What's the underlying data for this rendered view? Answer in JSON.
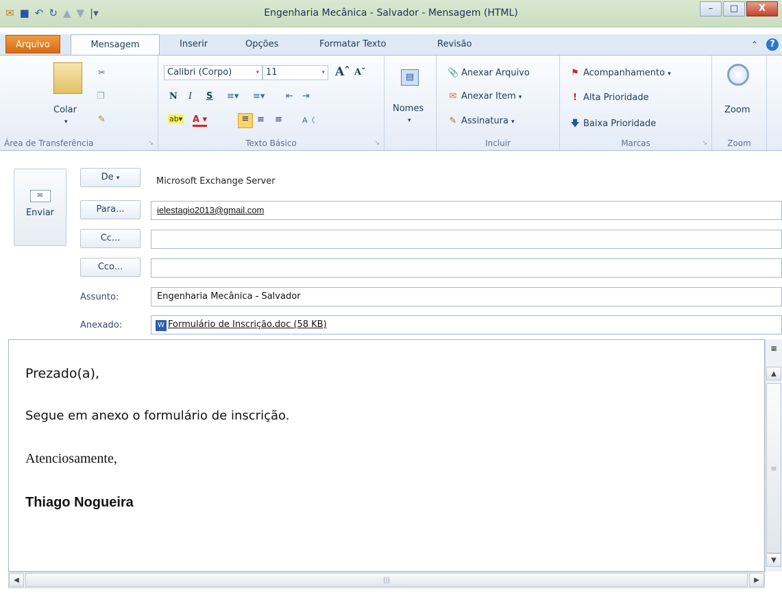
{
  "window": {
    "title": "Engenharia Mecânica - Salvador  -  Mensagem (HTML)",
    "minimize": "–",
    "maximize": "□",
    "close": "X"
  },
  "tabs": {
    "file": "Arquivo",
    "message": "Mensagem",
    "insert": "Inserir",
    "options": "Opções",
    "format": "Formatar Texto",
    "review": "Revisão"
  },
  "ribbon": {
    "clipboard": {
      "paste": "Colar",
      "label": "Área de Transferência"
    },
    "basic_text": {
      "font": "Calibri (Corpo)",
      "size": "11",
      "bold": "N",
      "italic": "I",
      "underline": "S",
      "label": "Texto Básico"
    },
    "names": {
      "button": "Nomes"
    },
    "include": {
      "attach_file": "Anexar Arquivo",
      "attach_item": "Anexar Item",
      "signature": "Assinatura",
      "label": "Incluir"
    },
    "tags": {
      "follow_up": "Acompanhamento",
      "high": "Alta Prioridade",
      "low": "Baixa Prioridade",
      "label": "Marcas"
    },
    "zoom": {
      "button": "Zoom",
      "label": "Zoom"
    }
  },
  "form": {
    "send": "Enviar",
    "from_button": "De",
    "from_value": "Microsoft Exchange Server",
    "to_button": "Para...",
    "to_value": "ielestagio2013@gmail.com",
    "cc_button": "Cc...",
    "cc_value": "",
    "bcc_button": "Cco...",
    "bcc_value": "",
    "subject_label": "Assunto:",
    "subject_value": "Engenharia Mecânica - Salvador",
    "attached_label": "Anexado:",
    "attachment": "Formulário de Inscrição.doc (58 KB)"
  },
  "body": {
    "greeting": "Prezado(a),",
    "line1": "Segue em anexo o formulário de inscrição.",
    "closing": "Atenciosamente,",
    "signature": "Thiago Nogueira"
  },
  "colors": {
    "file_tab": "#d66b15",
    "ribbon_bg": "#e4ecf7",
    "title_bar": "#c9ddbf"
  }
}
